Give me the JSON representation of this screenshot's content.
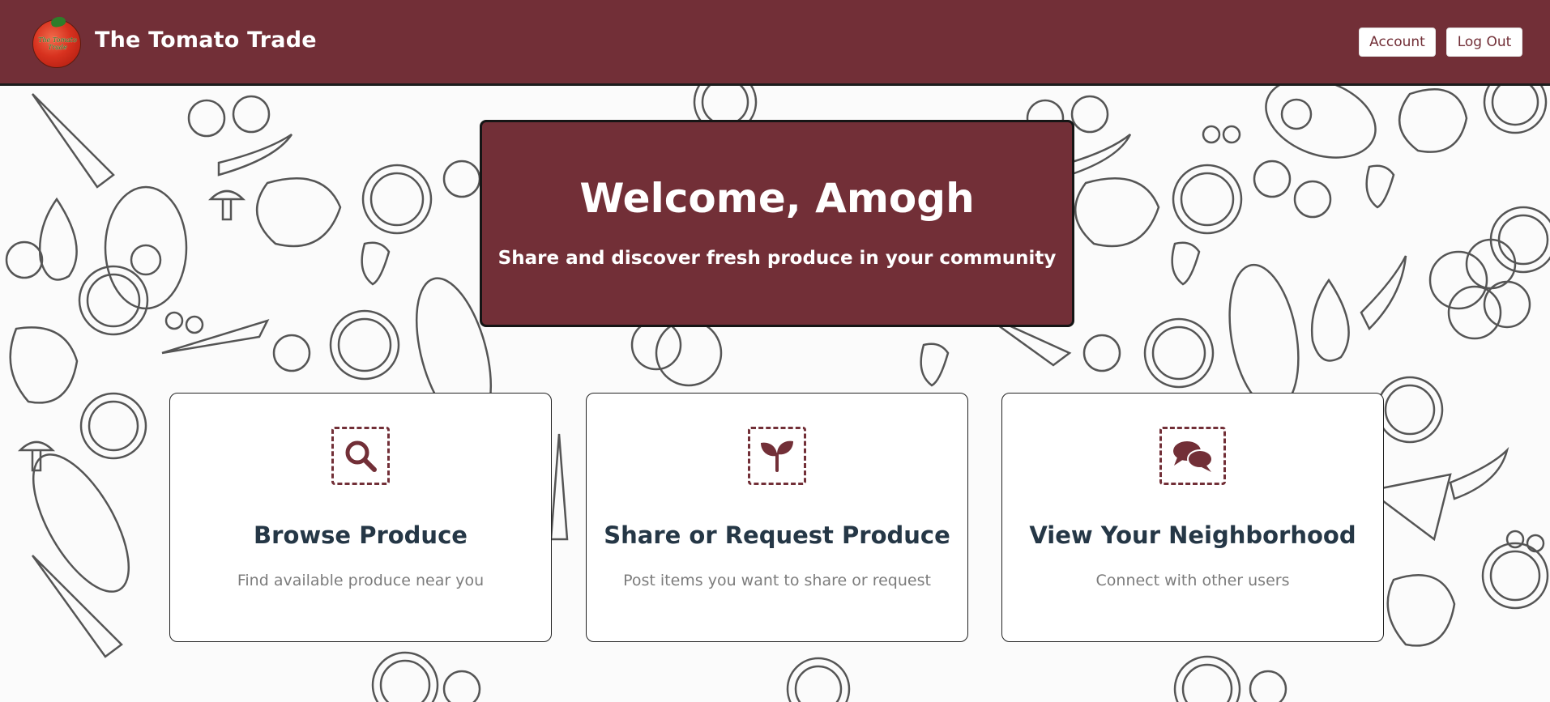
{
  "header": {
    "brand": "The Tomato Trade",
    "logo_icon": "tomato-logo",
    "logo_text": "The Tomato Trade",
    "account_label": "Account",
    "logout_label": "Log Out"
  },
  "welcome": {
    "title": "Welcome, Amogh",
    "subtitle": "Share and discover fresh produce in your community"
  },
  "cards": [
    {
      "icon": "search-icon",
      "title": "Browse Produce",
      "description": "Find available produce near you"
    },
    {
      "icon": "sprout-icon",
      "title": "Share or Request Produce",
      "description": "Post items you want to share or request"
    },
    {
      "icon": "chat-bubbles-icon",
      "title": "View Your Neighborhood",
      "description": "Connect with other users"
    }
  ],
  "colors": {
    "brand": "#722f37",
    "heading": "#253746",
    "muted": "#7c7c7c"
  }
}
